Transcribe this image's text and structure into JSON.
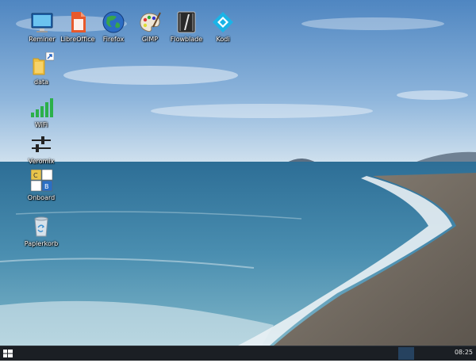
{
  "desktop": {
    "top_icons": [
      {
        "label": "Reminer",
        "icon": "monitor-icon"
      },
      {
        "label": "LibreOffice",
        "icon": "libreoffice-icon"
      },
      {
        "label": "Firefox",
        "icon": "firefox-globe-icon"
      },
      {
        "label": "GIMP",
        "icon": "gimp-palette-icon"
      },
      {
        "label": "Flowblade",
        "icon": "flowblade-icon"
      },
      {
        "label": "Kodi",
        "icon": "kodi-icon"
      }
    ],
    "left_icons": [
      {
        "label": "data",
        "icon": "folder-shortcut-icon"
      },
      {
        "label": "WiFi",
        "icon": "wifi-signal-icon"
      },
      {
        "label": "Veromix",
        "icon": "mixer-sliders-icon"
      },
      {
        "label": "Onboard",
        "icon": "keyboard-keys-icon"
      },
      {
        "label": "Papierkorb",
        "icon": "trash-icon"
      }
    ],
    "wallpaper": "beach-seascape"
  },
  "taskbar": {
    "start_icon": "windows-logo-icon",
    "clock": "08:25"
  },
  "colors": {
    "sky_top": "#4f86c1",
    "sea": "#3f7ea4",
    "taskbar": "#1b1f24"
  }
}
